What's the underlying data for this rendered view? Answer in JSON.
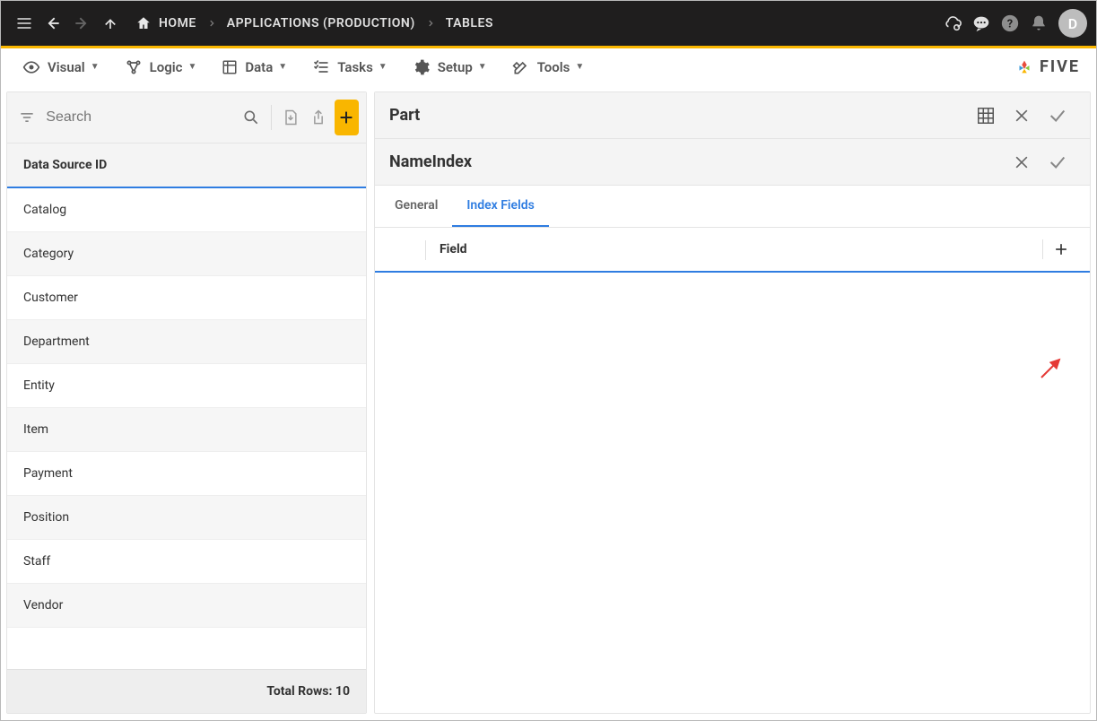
{
  "topbar": {
    "breadcrumbs": [
      "HOME",
      "APPLICATIONS (PRODUCTION)",
      "TABLES"
    ],
    "avatar_initial": "D"
  },
  "menubar": {
    "items": [
      {
        "label": "Visual"
      },
      {
        "label": "Logic"
      },
      {
        "label": "Data"
      },
      {
        "label": "Tasks"
      },
      {
        "label": "Setup"
      },
      {
        "label": "Tools"
      }
    ],
    "brand": "FIVE"
  },
  "left": {
    "search_placeholder": "Search",
    "header": "Data Source ID",
    "rows": [
      "Catalog",
      "Category",
      "Customer",
      "Department",
      "Entity",
      "Item",
      "Payment",
      "Position",
      "Staff",
      "Vendor"
    ],
    "footer_label": "Total Rows:",
    "footer_count": "10"
  },
  "right": {
    "panel_title": "Part",
    "sub_title": "NameIndex",
    "tabs": {
      "general": "General",
      "index_fields": "Index Fields"
    },
    "field_header": "Field"
  }
}
